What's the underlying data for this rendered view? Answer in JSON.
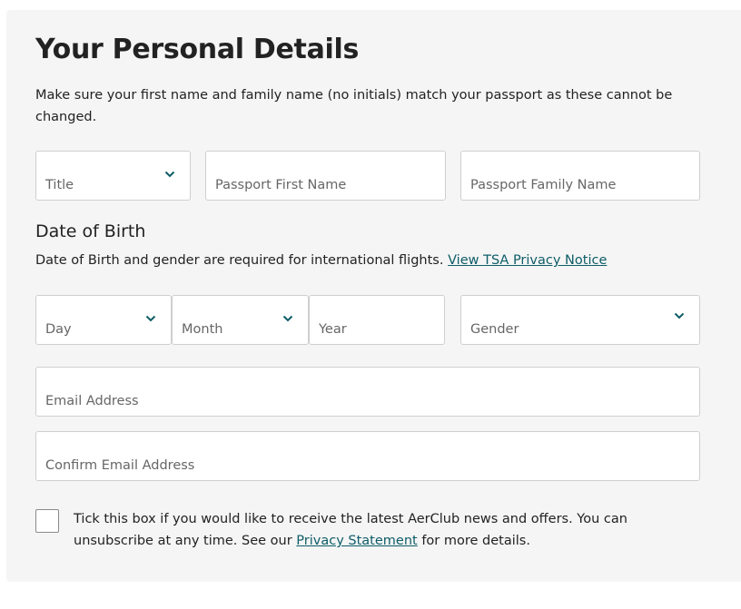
{
  "form": {
    "title": "Your Personal Details",
    "intro": "Make sure your first name and family name (no initials) match your passport as these cannot be changed.",
    "fields": {
      "title": "Title",
      "first_name": "Passport First Name",
      "family_name": "Passport Family Name",
      "day": "Day",
      "month": "Month",
      "year": "Year",
      "gender": "Gender",
      "email": "Email Address",
      "confirm_email": "Confirm Email Address"
    },
    "dob": {
      "heading": "Date of Birth",
      "note": "Date of Birth and gender are required for international flights.",
      "link": "View TSA Privacy Notice"
    },
    "consent": {
      "checked": false,
      "text": "Tick this box if you would like to receive the latest AerClub news and offers. You can unsubscribe at any time. See our",
      "link": "Privacy Statement",
      "suffix": "for more details."
    }
  },
  "colors": {
    "card_background": "#f5f5f5",
    "link": "#0e5d67",
    "chevron": "#0e5d67",
    "field_border": "#cfcfcf"
  },
  "icons": {
    "dropdown": "chevron-down-icon"
  }
}
